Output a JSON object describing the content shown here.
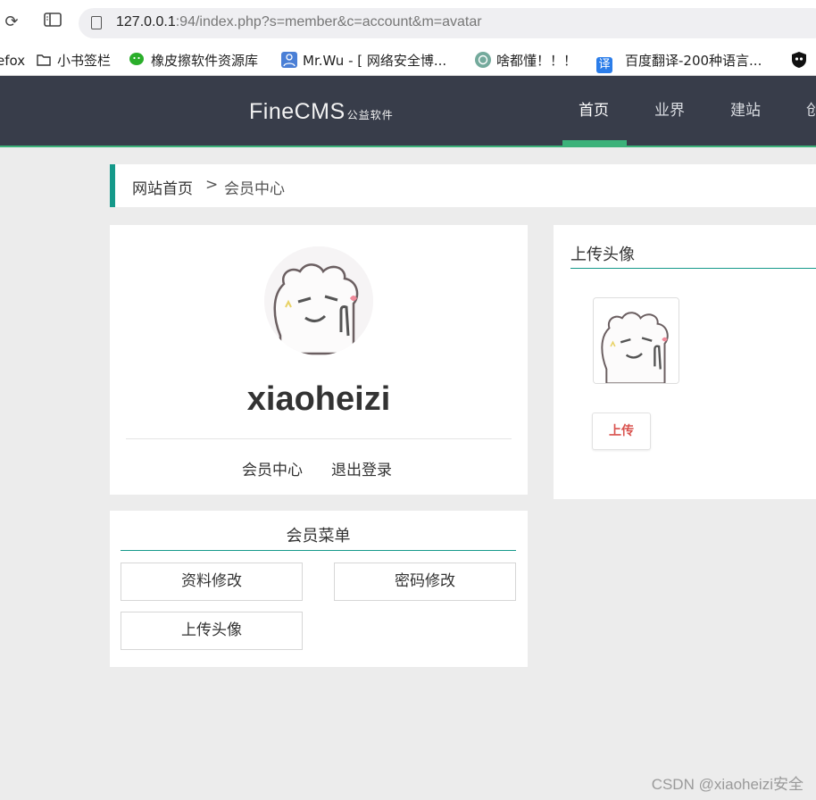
{
  "browser": {
    "url_host": "127.0.0.1",
    "url_rest": ":94/index.php?s=member&c=account&m=avatar",
    "bookmarks": [
      {
        "label": "efox"
      },
      {
        "label": "小书签栏",
        "icon": "folder-icon"
      },
      {
        "label": "橡皮擦软件资源库",
        "icon": "wechat-icon"
      },
      {
        "label": "Mr.Wu - [ 网络安全博...",
        "icon": "user-icon"
      },
      {
        "label": "啥都懂！！！",
        "icon": "chatgpt-icon"
      },
      {
        "label": "百度翻译-200种语言...",
        "icon": "translate-icon"
      }
    ],
    "translate_glyph": "译"
  },
  "site": {
    "logo_main": "FineCMS",
    "logo_sub": "公益软件",
    "nav": [
      {
        "label": "首页",
        "active": true
      },
      {
        "label": "业界"
      },
      {
        "label": "建站"
      },
      {
        "label": "创"
      }
    ]
  },
  "breadcrumb": {
    "home": "网站首页",
    "separator": ">",
    "current": "会员中心"
  },
  "profile": {
    "username": "xiaoheizi",
    "links": [
      "会员中心",
      "退出登录"
    ]
  },
  "member_menu": {
    "title": "会员菜单",
    "items": [
      "资料修改",
      "密码修改",
      "上传头像"
    ]
  },
  "upload": {
    "title": "上传头像",
    "button": "上传"
  },
  "watermark": "CSDN @xiaoheizi安全",
  "colors": {
    "header_bg": "#383d4a",
    "accent_green": "#3cb27a",
    "teal": "#15998a",
    "upload_red": "#d9534f"
  }
}
